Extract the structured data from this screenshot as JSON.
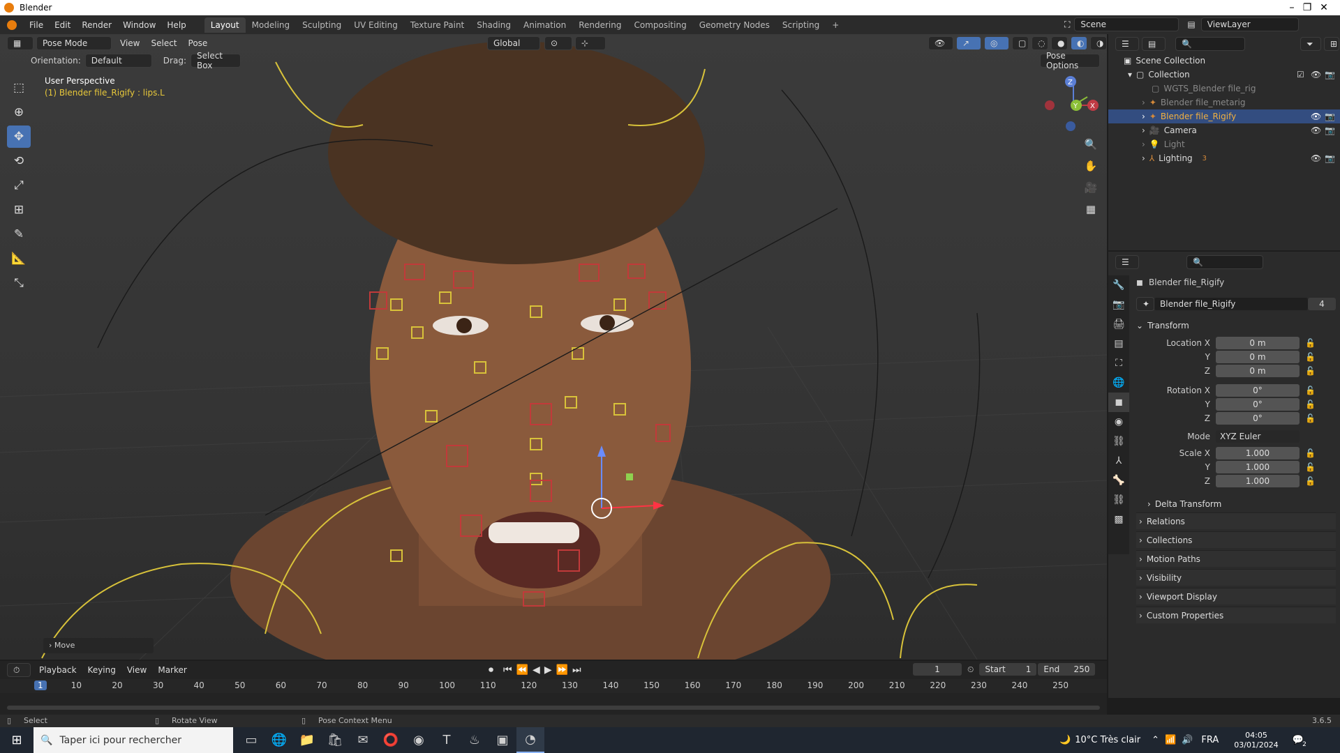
{
  "window": {
    "title": "Blender"
  },
  "menu": [
    "File",
    "Edit",
    "Render",
    "Window",
    "Help"
  ],
  "workspaces": [
    "Layout",
    "Modeling",
    "Sculpting",
    "UV Editing",
    "Texture Paint",
    "Shading",
    "Animation",
    "Rendering",
    "Compositing",
    "Geometry Nodes",
    "Scripting"
  ],
  "topbar": {
    "scene": "Scene",
    "view_layer": "ViewLayer"
  },
  "viewport": {
    "mode": "Pose Mode",
    "menus": [
      "View",
      "Select",
      "Pose"
    ],
    "transform_orientation": "Global",
    "orientation_label": "Orientation:",
    "orientation_value": "Default",
    "drag_label": "Drag:",
    "drag_value": "Select Box",
    "pose_options": "Pose Options",
    "overlay_title": "User Perspective",
    "overlay_subtitle": "(1) Blender file_Rigify : lips.L",
    "last_op": "Move",
    "gizmo": {
      "z": "Z",
      "y": "Y",
      "x": "X"
    }
  },
  "outliner": {
    "root": "Scene Collection",
    "collection": "Collection",
    "items": [
      {
        "name": "WGTS_Blender file_rig",
        "dim": true
      },
      {
        "name": "Blender file_metarig",
        "dim": true
      },
      {
        "name": "Blender file_Rigify",
        "selected": true
      },
      {
        "name": "Camera"
      },
      {
        "name": "Light",
        "dim": true
      },
      {
        "name": "Lighting",
        "badge": "3"
      }
    ]
  },
  "properties": {
    "object_name": "Blender file_Rigify",
    "data_name": "Blender file_Rigify",
    "users": "4",
    "transform_header": "Transform",
    "location": {
      "label_x": "Location X",
      "label_y": "Y",
      "label_z": "Z",
      "x": "0 m",
      "y": "0 m",
      "z": "0 m"
    },
    "rotation": {
      "label_x": "Rotation X",
      "label_y": "Y",
      "label_z": "Z",
      "x": "0°",
      "y": "0°",
      "z": "0°"
    },
    "mode_label": "Mode",
    "mode_value": "XYZ Euler",
    "scale": {
      "label_x": "Scale X",
      "label_y": "Y",
      "label_z": "Z",
      "x": "1.000",
      "y": "1.000",
      "z": "1.000"
    },
    "delta_transform": "Delta Transform",
    "panels": [
      "Relations",
      "Collections",
      "Motion Paths",
      "Visibility",
      "Viewport Display",
      "Custom Properties"
    ]
  },
  "timeline": {
    "menus": [
      "Playback",
      "Keying",
      "View",
      "Marker"
    ],
    "current_frame": "1",
    "start_label": "Start",
    "start": "1",
    "end_label": "End",
    "end": "250",
    "ticks": [
      "1",
      "10",
      "20",
      "30",
      "40",
      "50",
      "60",
      "70",
      "80",
      "90",
      "100",
      "110",
      "120",
      "130",
      "140",
      "150",
      "160",
      "170",
      "180",
      "190",
      "200",
      "210",
      "220",
      "230",
      "240",
      "250"
    ]
  },
  "statusbar": {
    "select": "Select",
    "rotate": "Rotate View",
    "context": "Pose Context Menu",
    "version": "3.6.5"
  },
  "taskbar": {
    "search_placeholder": "Taper ici pour rechercher",
    "weather": "10°C  Très clair",
    "lang": "FRA",
    "time": "04:05",
    "date": "03/01/2024",
    "notif": "2"
  }
}
